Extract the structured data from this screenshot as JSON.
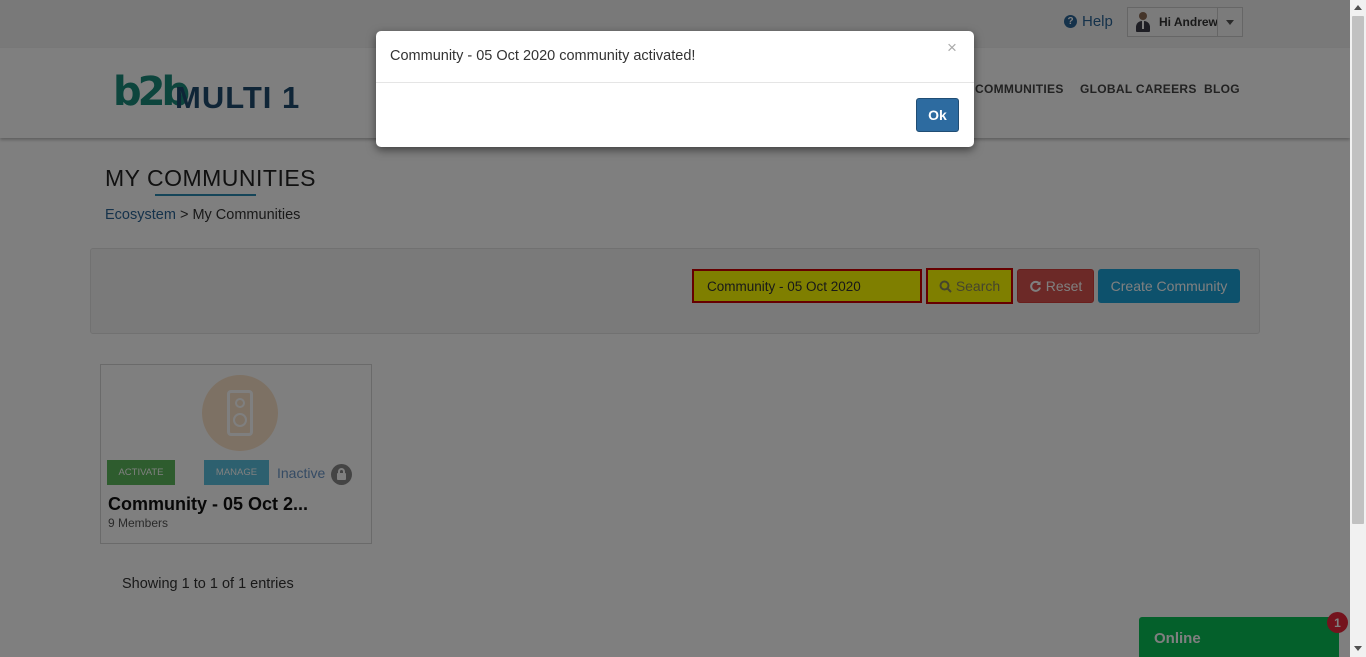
{
  "topbar": {
    "help_label": "Help",
    "help_icon": "question-circle-icon",
    "user_greeting": "Hi Andrew"
  },
  "header": {
    "logo_mark": "b2b",
    "logo_text": "MULTI 1",
    "nav_items": [
      "COMMUNITIES",
      "GLOBAL CAREERS",
      "BLOG"
    ]
  },
  "page": {
    "title": "MY COMMUNITIES",
    "breadcrumb_link": "Ecosystem",
    "breadcrumb_separator": ">",
    "breadcrumb_current": "My Communities"
  },
  "filter": {
    "search_value": "Community - 05 Oct 2020",
    "search_label": "Search",
    "reset_label": "Reset",
    "create_label": "Create Community"
  },
  "card": {
    "activate_label": "ACTIVATE",
    "manage_label": "MANAGE",
    "status": "Inactive",
    "title": "Community - 05 Oct 2...",
    "members": "9 Members"
  },
  "footer": {
    "showing": "Showing 1 to 1 of 1 entries"
  },
  "chat": {
    "label": "Online",
    "badge_count": "1"
  },
  "modal": {
    "message": "Community - 05 Oct 2020 community activated!",
    "close_symbol": "×",
    "ok_label": "Ok"
  },
  "colors": {
    "highlight_yellow": "#ffff00",
    "highlight_red_border": "#cc0000",
    "activate_green": "#5cb85c",
    "manage_blue": "#5bc0de",
    "reset_red": "#d9534f",
    "create_blue": "#1aa3d8",
    "ok_blue": "#2d6ba0",
    "chat_green": "#08c157"
  }
}
